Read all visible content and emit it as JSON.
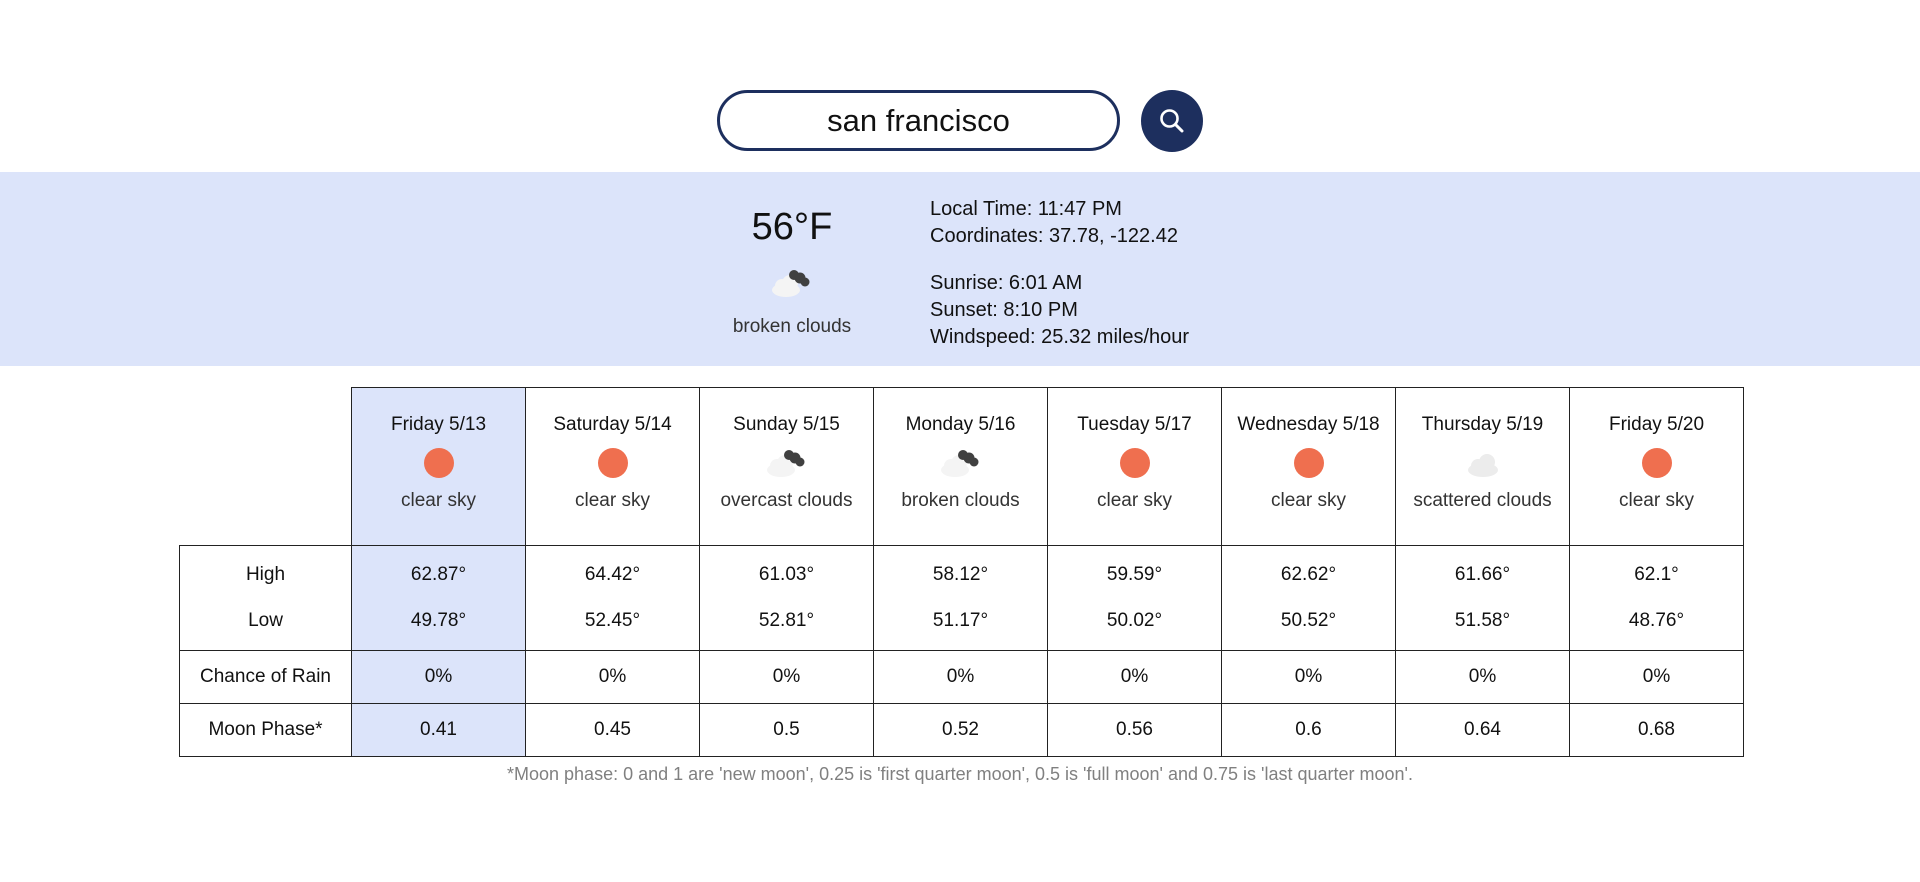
{
  "search": {
    "value": "san francisco",
    "button_icon": "search-icon"
  },
  "current": {
    "temperature": "56°F",
    "icon": "broken-clouds-icon",
    "description": "broken clouds",
    "local_time": "Local Time: 11:47 PM",
    "coordinates": "Coordinates: 37.78, -122.42",
    "sunrise": "Sunrise: 6:01 AM",
    "sunset": "Sunset: 8:10 PM",
    "windspeed": "Windspeed: 25.32 miles/hour"
  },
  "forecast": {
    "row_labels": {
      "high": "High",
      "low": "Low",
      "rain": "Chance of Rain",
      "moon": "Moon Phase*"
    },
    "days": [
      {
        "name": "Friday 5/13",
        "icon": "sun-icon",
        "description": "clear sky",
        "high": "62.87°",
        "low": "49.78°",
        "rain": "0%",
        "moon": "0.41"
      },
      {
        "name": "Saturday 5/14",
        "icon": "sun-icon",
        "description": "clear sky",
        "high": "64.42°",
        "low": "52.45°",
        "rain": "0%",
        "moon": "0.45"
      },
      {
        "name": "Sunday 5/15",
        "icon": "broken-clouds-icon",
        "description": "overcast clouds",
        "high": "61.03°",
        "low": "52.81°",
        "rain": "0%",
        "moon": "0.5"
      },
      {
        "name": "Monday 5/16",
        "icon": "broken-clouds-icon",
        "description": "broken clouds",
        "high": "58.12°",
        "low": "51.17°",
        "rain": "0%",
        "moon": "0.52"
      },
      {
        "name": "Tuesday 5/17",
        "icon": "sun-icon",
        "description": "clear sky",
        "high": "59.59°",
        "low": "50.02°",
        "rain": "0%",
        "moon": "0.56"
      },
      {
        "name": "Wednesday 5/18",
        "icon": "sun-icon",
        "description": "clear sky",
        "high": "62.62°",
        "low": "50.52°",
        "rain": "0%",
        "moon": "0.6"
      },
      {
        "name": "Thursday 5/19",
        "icon": "scattered-clouds-icon",
        "description": "scattered clouds",
        "high": "61.66°",
        "low": "51.58°",
        "rain": "0%",
        "moon": "0.64"
      },
      {
        "name": "Friday 5/20",
        "icon": "sun-icon",
        "description": "clear sky",
        "high": "62.1°",
        "low": "48.76°",
        "rain": "0%",
        "moon": "0.68"
      }
    ]
  },
  "footnote": "*Moon phase: 0 and 1 are 'new moon', 0.25 is 'first quarter moon', 0.5 is 'full moon' and 0.75 is 'last quarter moon'.",
  "colors": {
    "accent": "#1d2f5e",
    "panel": "#dce4fa",
    "sun": "#ef6f4f"
  }
}
